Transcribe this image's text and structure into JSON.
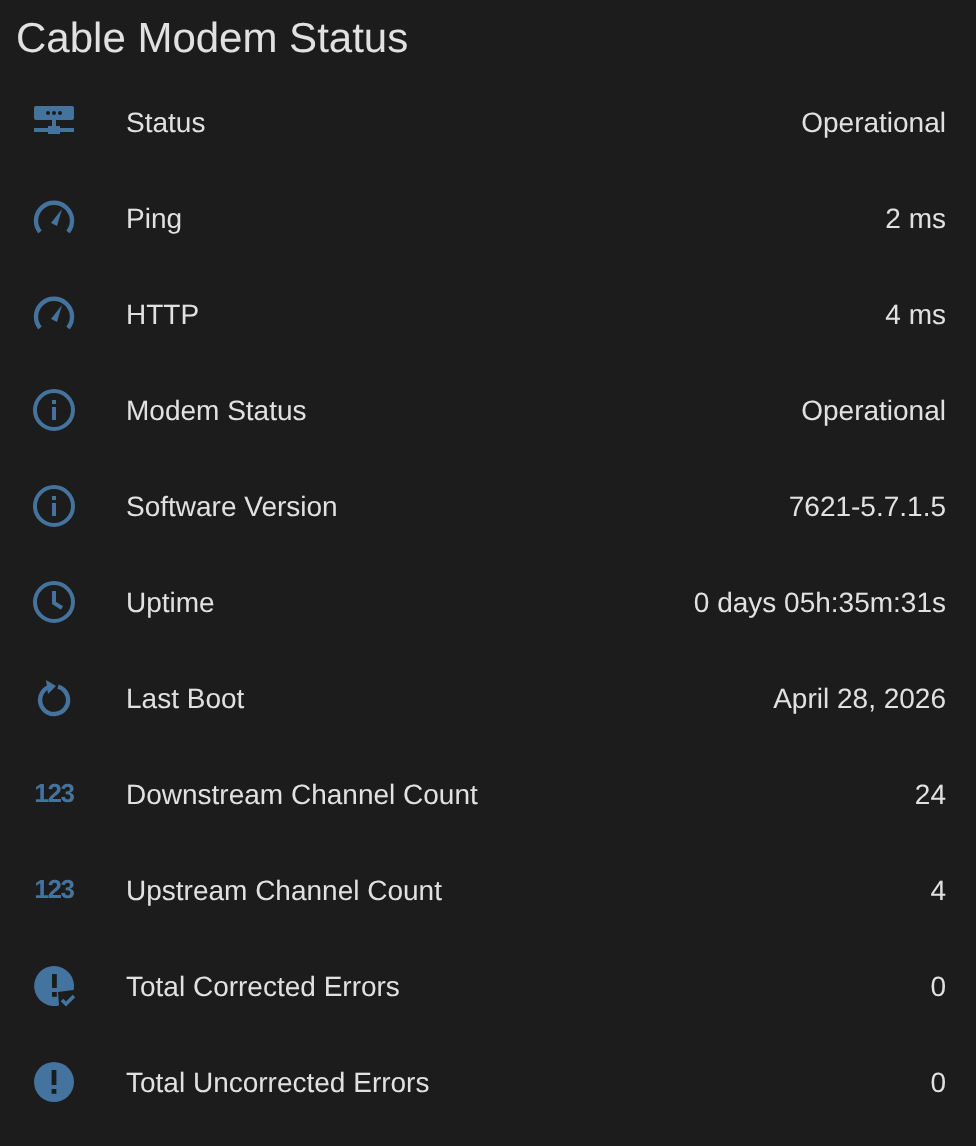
{
  "title": "Cable Modem Status",
  "rows": [
    {
      "kind": "network",
      "label": "Status",
      "value": "Operational"
    },
    {
      "kind": "gauge",
      "label": "Ping",
      "value": "2 ms"
    },
    {
      "kind": "gauge",
      "label": "HTTP",
      "value": "4 ms"
    },
    {
      "kind": "info",
      "label": "Modem Status",
      "value": "Operational"
    },
    {
      "kind": "info",
      "label": "Software Version",
      "value": "7621-5.7.1.5"
    },
    {
      "kind": "clock",
      "label": "Uptime",
      "value": "0 days 05h:35m:31s"
    },
    {
      "kind": "restart",
      "label": "Last Boot",
      "value": "April 28, 2026"
    },
    {
      "kind": "numeric",
      "icon_text": "123",
      "label": "Downstream Channel Count",
      "value": "24"
    },
    {
      "kind": "numeric",
      "icon_text": "123",
      "label": "Upstream Channel Count",
      "value": "4"
    },
    {
      "kind": "alertcheck",
      "label": "Total Corrected Errors",
      "value": "0"
    },
    {
      "kind": "alert",
      "label": "Total Uncorrected Errors",
      "value": "0"
    }
  ]
}
